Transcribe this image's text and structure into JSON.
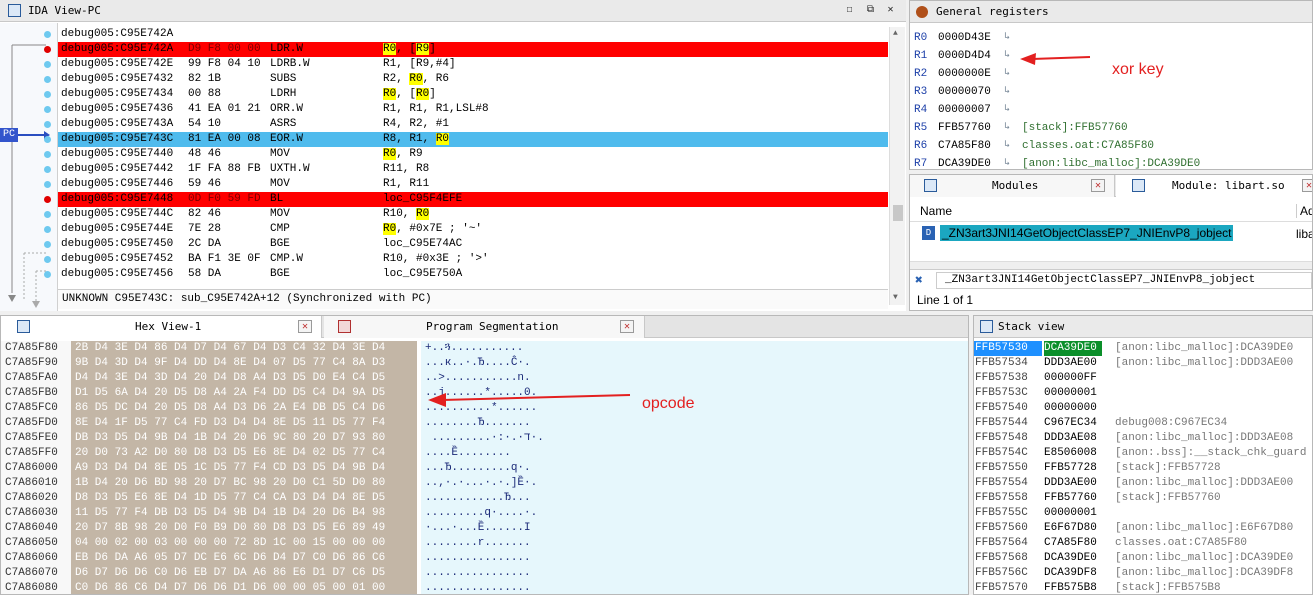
{
  "ida_view": {
    "title": "IDA View-PC",
    "pc_label": "PC",
    "lines": [
      {
        "addr": "debug005:C95E742A",
        "bytes": "",
        "mn": "",
        "ops": [],
        "hl": "",
        "bp": false
      },
      {
        "addr": "debug005:C95E742A",
        "bytes": "D9 F8 00 00",
        "mn": "LDR.W",
        "ops": [
          {
            "t": "R0",
            "y": true
          },
          {
            "t": ", [",
            "y": false
          },
          {
            "t": "R9",
            "y": true
          },
          {
            "t": "]",
            "y": false
          }
        ],
        "hl": "red",
        "bp": true
      },
      {
        "addr": "debug005:C95E742E",
        "bytes": "99 F8 04 10",
        "mn": "LDRB.W",
        "ops": [
          {
            "t": "R1, [R9,#4]",
            "y": false
          }
        ],
        "hl": "",
        "bp": false
      },
      {
        "addr": "debug005:C95E7432",
        "bytes": "82 1B",
        "mn": "SUBS",
        "ops": [
          {
            "t": "R2, ",
            "y": false
          },
          {
            "t": "R0",
            "y": true
          },
          {
            "t": ", R6",
            "y": false
          }
        ],
        "hl": "",
        "bp": false
      },
      {
        "addr": "debug005:C95E7434",
        "bytes": "00 88",
        "mn": "LDRH",
        "ops": [
          {
            "t": "R0",
            "y": true
          },
          {
            "t": ", [",
            "y": false
          },
          {
            "t": "R0",
            "y": true
          },
          {
            "t": "]",
            "y": false
          }
        ],
        "hl": "",
        "bp": false
      },
      {
        "addr": "debug005:C95E7436",
        "bytes": "41 EA 01 21",
        "mn": "ORR.W",
        "ops": [
          {
            "t": "R1, R1, R1,LSL#8",
            "y": false
          }
        ],
        "hl": "",
        "bp": false
      },
      {
        "addr": "debug005:C95E743A",
        "bytes": "54 10",
        "mn": "ASRS",
        "ops": [
          {
            "t": "R4, R2, #1",
            "y": false
          }
        ],
        "hl": "",
        "bp": false
      },
      {
        "addr": "debug005:C95E743C",
        "bytes": "81 EA 00 08",
        "mn": "EOR.W",
        "ops": [
          {
            "t": "R8, R1, ",
            "y": false
          },
          {
            "t": "R0",
            "y": true
          }
        ],
        "hl": "blue",
        "bp": false
      },
      {
        "addr": "debug005:C95E7440",
        "bytes": "48 46",
        "mn": "MOV",
        "ops": [
          {
            "t": "R0",
            "y": true
          },
          {
            "t": ", R9",
            "y": false
          }
        ],
        "hl": "",
        "bp": false
      },
      {
        "addr": "debug005:C95E7442",
        "bytes": "1F FA 88 FB",
        "mn": "UXTH.W",
        "ops": [
          {
            "t": "R11, R8",
            "y": false
          }
        ],
        "hl": "",
        "bp": false
      },
      {
        "addr": "debug005:C95E7446",
        "bytes": "59 46",
        "mn": "MOV",
        "ops": [
          {
            "t": "R1, R11",
            "y": false
          }
        ],
        "hl": "",
        "bp": false
      },
      {
        "addr": "debug005:C95E7448",
        "bytes": "0D F0 59 FD",
        "mn": "BL",
        "ops": [
          {
            "t": "loc_C95F4EFE",
            "y": false
          }
        ],
        "hl": "red",
        "bp": true
      },
      {
        "addr": "debug005:C95E744C",
        "bytes": "82 46",
        "mn": "MOV",
        "ops": [
          {
            "t": "R10, ",
            "y": false
          },
          {
            "t": "R0",
            "y": true
          }
        ],
        "hl": "",
        "bp": false
      },
      {
        "addr": "debug005:C95E744E",
        "bytes": "7E 28",
        "mn": "CMP",
        "ops": [
          {
            "t": "R0",
            "y": true
          },
          {
            "t": ", #0x7E ; '~'",
            "y": false
          }
        ],
        "hl": "",
        "bp": false
      },
      {
        "addr": "debug005:C95E7450",
        "bytes": "2C DA",
        "mn": "BGE",
        "ops": [
          {
            "t": "loc_C95E74AC",
            "y": false
          }
        ],
        "hl": "",
        "bp": false
      },
      {
        "addr": "debug005:C95E7452",
        "bytes": "BA F1 3E 0F",
        "mn": "CMP.W",
        "ops": [
          {
            "t": "R10, #0x3E ; '>'",
            "y": false
          }
        ],
        "hl": "",
        "bp": false
      },
      {
        "addr": "debug005:C95E7456",
        "bytes": "58 DA",
        "mn": "BGE",
        "ops": [
          {
            "t": "loc_C95E750A",
            "y": false
          }
        ],
        "hl": "",
        "bp": false
      }
    ],
    "status": "UNKNOWN C95E743C: sub_C95E742A+12 (Synchronized with PC)"
  },
  "registers": {
    "title": "General registers",
    "rows": [
      {
        "name": "R0",
        "value": "0000D43E",
        "info": ""
      },
      {
        "name": "R1",
        "value": "0000D4D4",
        "info": ""
      },
      {
        "name": "R2",
        "value": "0000000E",
        "info": ""
      },
      {
        "name": "R3",
        "value": "00000070",
        "info": ""
      },
      {
        "name": "R4",
        "value": "00000007",
        "info": ""
      },
      {
        "name": "R5",
        "value": "FFB57760",
        "info": "[stack]:FFB57760"
      },
      {
        "name": "R6",
        "value": "C7A85F80",
        "info": "classes.oat:C7A85F80"
      },
      {
        "name": "R7",
        "value": "DCA39DE0",
        "info": "[anon:libc_malloc]:DCA39DE0"
      }
    ]
  },
  "modules": {
    "tab1": "Modules",
    "tab2": "Module: libart.so",
    "col_name": "Name",
    "col_addr": "Ad",
    "item": "_ZN3art3JNI14GetObjectClassEP7_JNIEnvP8_jobject",
    "item_addr": "liba",
    "filter": "_ZN3art3JNI14GetObjectClassEP7_JNIEnvP8_jobject",
    "line_info": "Line 1 of 1"
  },
  "hex_view": {
    "tab1": "Hex View-1",
    "tab2": "Program Segmentation",
    "rows": [
      {
        "addr": "C7A85F80",
        "bytes": "2B D4 3E D4 86 D4 D7 D4 67 D4 D3 C4 32 D4 3E D4",
        "ascii": "+..ጓ..........."
      },
      {
        "addr": "C7A85F90",
        "bytes": "9B D4 3D D4 9F D4 DD D4 8E D4 07 D5 77 C4 8A D3",
        "ascii": "...к..·.Ђ....Ĉ·."
      },
      {
        "addr": "C7A85FA0",
        "bytes": "D4 D4 3E D4 3D D4 20 D4 D8 A4 D3 D5 D0 E4 C4 D5",
        "ascii": "..>...........n."
      },
      {
        "addr": "C7A85FB0",
        "bytes": "D1 D5 6A D4 20 D5 D8 A4 2A F4 DD D5 C4 D4 9A D5",
        "ascii": "..j......*.....0."
      },
      {
        "addr": "C7A85FC0",
        "bytes": "86 D5 DC D4 20 D5 D8 A4 D3 D6 2A E4 DB D5 C4 D6",
        "ascii": "..........*......"
      },
      {
        "addr": "C7A85FD0",
        "bytes": "8E D4 1F D5 77 C4 FD D3 D4 D4 8E D5 11 D5 77 F4",
        "ascii": "........Ђ......."
      },
      {
        "addr": "C7A85FE0",
        "bytes": "DB D3 D5 D4 9B D4 1B D4 20 D6 9C 80 20 D7 93 80",
        "ascii": " .........·:·.·ד·."
      },
      {
        "addr": "C7A85FF0",
        "bytes": "20 D0 73 A2 D0 80 D8 D3 D5 E6 8E D4 02 D5 77 C4",
        "ascii": "....Ȅ........"
      },
      {
        "addr": "C7A86000",
        "bytes": "A9 D3 D4 D4 8E D5 1C D5 77 F4 CD D3 D5 D4 9B D4",
        "ascii": "...Ђ.........q·."
      },
      {
        "addr": "C7A86010",
        "bytes": "1B D4 20 D6 BD 98 20 D7 BC 98 20 D0 C1 5D D0 80",
        "ascii": "..,·.·...·.·.]Ȅ·."
      },
      {
        "addr": "C7A86020",
        "bytes": "D8 D3 D5 E6 8E D4 1D D5 77 C4 CA D3 D4 D4 8E D5",
        "ascii": "............Ђ..."
      },
      {
        "addr": "C7A86030",
        "bytes": "11 D5 77 F4 DB D3 D5 D4 9B D4 1B D4 20 D6 B4 98",
        "ascii": ".........q·....·."
      },
      {
        "addr": "C7A86040",
        "bytes": "20 D7 8B 98 20 D0 F0 B9 D0 80 D8 D3 D5 E6 89 49",
        "ascii": "·...·...Ȅ......I"
      },
      {
        "addr": "C7A86050",
        "bytes": "04 00 02 00 03 00 00 00 72 8D 1C 00 15 00 00 00",
        "ascii": "........r......."
      },
      {
        "addr": "C7A86060",
        "bytes": "EB D6 DA A6 05 D7 DC E6 6C D6 D4 D7 C0 D6 86 C6",
        "ascii": "................"
      },
      {
        "addr": "C7A86070",
        "bytes": "D6 D7 D6 D6 C0 D6 EB D7 DA A6 86 E6 D1 D7 C6 D5",
        "ascii": "................"
      },
      {
        "addr": "C7A86080",
        "bytes": "C0 D6 86 C6 D4 D7 D6 D6 D1 D6 00 00 05 00 01 00",
        "ascii": "................"
      }
    ]
  },
  "stack": {
    "title": "Stack view",
    "rows": [
      {
        "addr": "FFB57530",
        "value": "DCA39DE0",
        "info": "[anon:libc_malloc]:DCA39DE0"
      },
      {
        "addr": "FFB57534",
        "value": "DDD3AE00",
        "info": "[anon:libc_malloc]:DDD3AE00"
      },
      {
        "addr": "FFB57538",
        "value": "000000FF",
        "info": ""
      },
      {
        "addr": "FFB5753C",
        "value": "00000001",
        "info": ""
      },
      {
        "addr": "FFB57540",
        "value": "00000000",
        "info": ""
      },
      {
        "addr": "FFB57544",
        "value": "C967EC34",
        "info": "debug008:C967EC34"
      },
      {
        "addr": "FFB57548",
        "value": "DDD3AE08",
        "info": "[anon:libc_malloc]:DDD3AE08"
      },
      {
        "addr": "FFB5754C",
        "value": "E8506008",
        "info": "[anon:.bss]:__stack_chk_guard"
      },
      {
        "addr": "FFB57550",
        "value": "FFB57728",
        "info": "[stack]:FFB57728"
      },
      {
        "addr": "FFB57554",
        "value": "DDD3AE00",
        "info": "[anon:libc_malloc]:DDD3AE00"
      },
      {
        "addr": "FFB57558",
        "value": "FFB57760",
        "info": "[stack]:FFB57760"
      },
      {
        "addr": "FFB5755C",
        "value": "00000001",
        "info": ""
      },
      {
        "addr": "FFB57560",
        "value": "E6F67D80",
        "info": "[anon:libc_malloc]:E6F67D80"
      },
      {
        "addr": "FFB57564",
        "value": "C7A85F80",
        "info": "classes.oat:C7A85F80"
      },
      {
        "addr": "FFB57568",
        "value": "DCA39DE0",
        "info": "[anon:libc_malloc]:DCA39DE0"
      },
      {
        "addr": "FFB5756C",
        "value": "DCA39DF8",
        "info": "[anon:libc_malloc]:DCA39DF8"
      },
      {
        "addr": "FFB57570",
        "value": "FFB575B8",
        "info": "[stack]:FFB575B8"
      }
    ]
  },
  "annotations": {
    "xor_key": "xor key",
    "opcode": "opcode"
  },
  "colors": {
    "breakpoint": "#ff0000",
    "current": "#4fbbed",
    "register_highlight": "#ffff00",
    "hex_bg": "#c3b6a6",
    "hex_ascii_bg": "#e6f7fc",
    "annotation": "#e32020"
  }
}
